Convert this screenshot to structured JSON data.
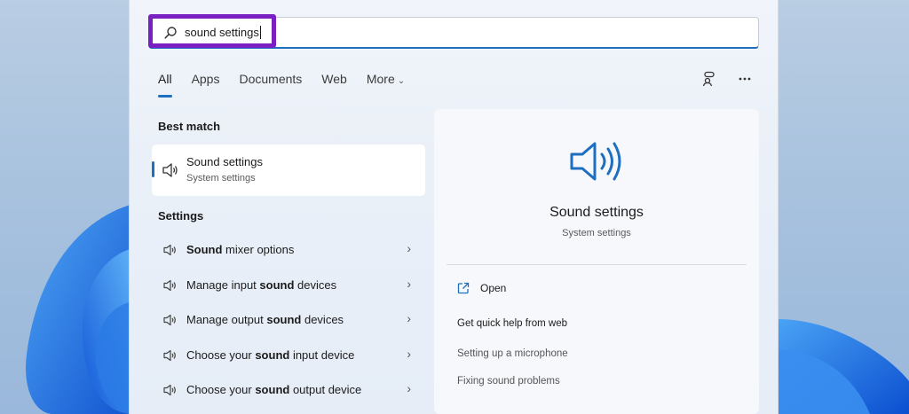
{
  "search": {
    "query": "sound settings"
  },
  "tabs": [
    {
      "label": "All"
    },
    {
      "label": "Apps"
    },
    {
      "label": "Documents"
    },
    {
      "label": "Web"
    },
    {
      "label": "More"
    }
  ],
  "left": {
    "best_match_title": "Best match",
    "best_match": {
      "title": "Sound settings",
      "subtitle": "System settings"
    },
    "settings_title": "Settings",
    "settings_items": [
      {
        "bold": "Sound",
        "pre": "",
        "post": " mixer options"
      },
      {
        "pre": "Manage input ",
        "bold": "sound",
        "post": " devices"
      },
      {
        "pre": "Manage output ",
        "bold": "sound",
        "post": " devices"
      },
      {
        "pre": "Choose your ",
        "bold": "sound",
        "post": " input device"
      },
      {
        "pre": "Choose your ",
        "bold": "sound",
        "post": " output device"
      }
    ]
  },
  "preview": {
    "title": "Sound settings",
    "subtitle": "System settings",
    "open_label": "Open",
    "help_title": "Get quick help from web",
    "help_links": [
      "Setting up a microphone",
      "Fixing sound problems"
    ]
  },
  "colors": {
    "accent": "#1f6fc0",
    "highlight": "#7a1fc2"
  }
}
